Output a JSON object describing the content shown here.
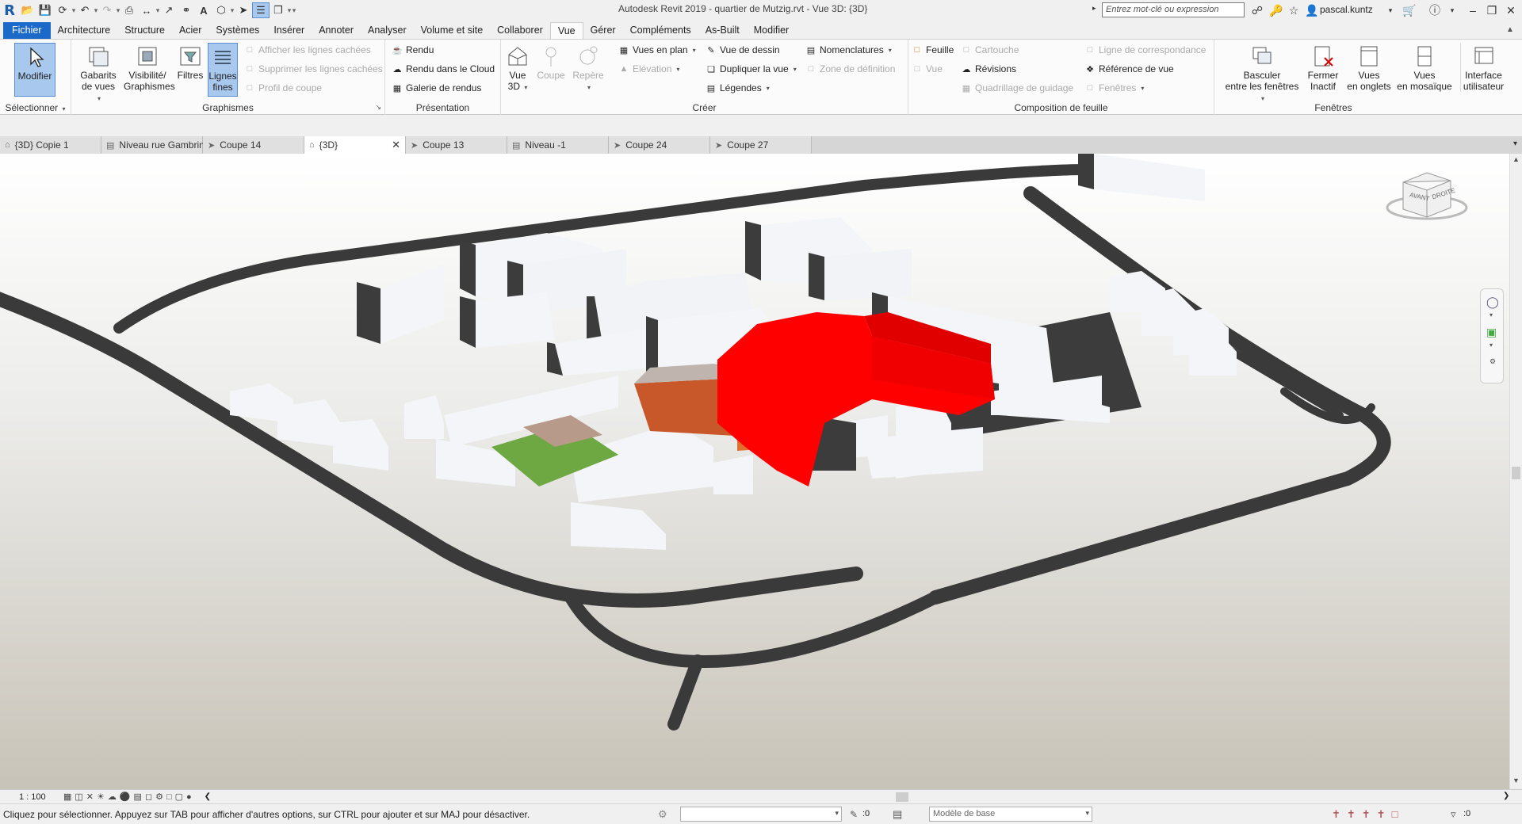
{
  "titlebar": {
    "title": "Autodesk Revit 2019 - quartier de Mutzig.rvt - Vue 3D: {3D}",
    "search_placeholder": "Entrez mot-clé ou expression",
    "user": "pascal.kuntz"
  },
  "ribbon_tabs": [
    "Fichier",
    "Architecture",
    "Structure",
    "Acier",
    "Systèmes",
    "Insérer",
    "Annoter",
    "Analyser",
    "Volume et site",
    "Collaborer",
    "Vue",
    "Gérer",
    "Compléments",
    "As-Built",
    "Modifier"
  ],
  "active_tab": "Vue",
  "ribbon": {
    "select": {
      "modify": "Modifier",
      "title": "Sélectionner"
    },
    "graphismes": {
      "title": "Graphismes",
      "gabarits": [
        "Gabarits",
        "de vues"
      ],
      "visibilite": [
        "Visibilité/",
        "Graphismes"
      ],
      "filtres": "Filtres",
      "lignes": [
        "Lignes",
        "fines"
      ],
      "afficher": "Afficher les lignes cachées",
      "supprimer": "Supprimer les lignes cachées",
      "profil": "Profil de coupe"
    },
    "presentation": {
      "title": "Présentation",
      "rendu": "Rendu",
      "rendu_cloud": "Rendu  dans le Cloud",
      "galerie": "Galerie  de rendus"
    },
    "creer": {
      "title": "Créer",
      "vue3d": [
        "Vue",
        "3D"
      ],
      "coupe": "Coupe",
      "repere": "Repère",
      "vues_plan": "Vues en plan",
      "elevation": "Elévation",
      "vue_dessin": "Vue de dessin",
      "dupliquer": "Dupliquer la vue",
      "legendes": "Légendes",
      "nomenclatures": "Nomenclatures",
      "zone_def": "Zone de définition"
    },
    "composition": {
      "title": "Composition de feuille",
      "feuille": "Feuille",
      "vue": "Vue",
      "cartouche": "Cartouche",
      "revisions": "Révisions",
      "quadrillage": "Quadrillage de guidage",
      "ligne_corr": "Ligne de correspondance",
      "ref_vue": "Référence de vue",
      "fenetres": "Fenêtres"
    },
    "fenetres": {
      "title": "Fenêtres",
      "basculer": [
        "Basculer",
        "entre les fenêtres"
      ],
      "fermer": [
        "Fermer",
        "Inactif"
      ],
      "onglets": [
        "Vues",
        "en onglets"
      ],
      "mosaique": [
        "Vues",
        "en mosaïque"
      ],
      "interface": [
        "Interface",
        "utilisateur"
      ]
    }
  },
  "view_tabs": [
    "{3D} Copie 1",
    "Niveau rue Gambrinus",
    "Coupe 14",
    "{3D}",
    "Coupe 13",
    "Niveau -1",
    "Coupe 24",
    "Coupe 27"
  ],
  "active_view_tab": "{3D}",
  "viewcube": {
    "face_front": "AVANT",
    "face_right": "DROITE"
  },
  "view_control": {
    "scale": "1 : 100"
  },
  "status": {
    "message": "Cliquez pour sélectionner. Appuyez sur TAB pour afficher d'autres options, sur CTRL pour ajouter et sur MAJ pour désactiver.",
    "counter_a": ":0",
    "model": "Modèle de base",
    "counter_b": ":0"
  },
  "colors": {
    "accent": "#1b6ac9",
    "highlight": "#ff0000",
    "road": "#3a3a3a"
  }
}
